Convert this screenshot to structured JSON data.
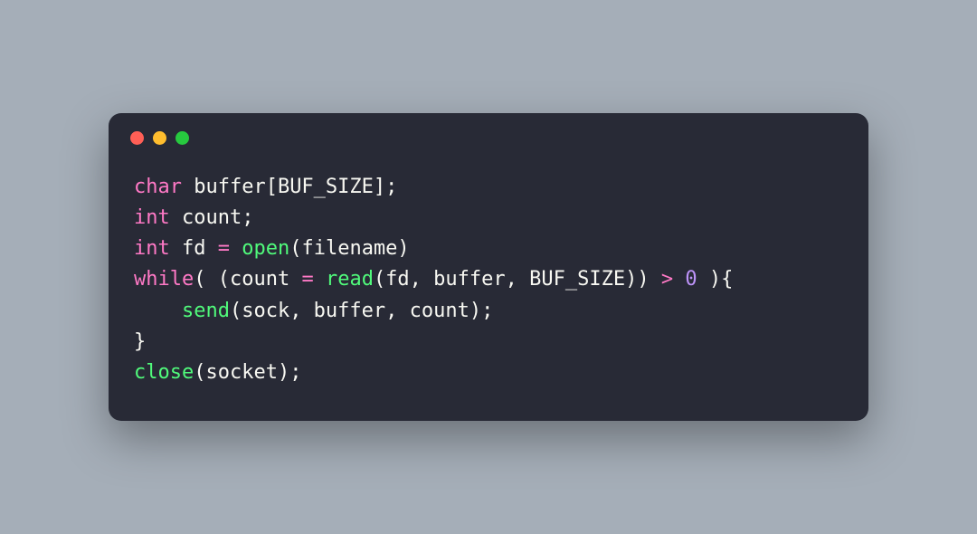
{
  "traffic_lights": {
    "red": "#ff5f56",
    "yellow": "#ffbd2e",
    "green": "#27c93f"
  },
  "code": {
    "tokens": [
      {
        "t": "char",
        "c": "kw-type"
      },
      {
        "t": " buffer[BUF_SIZE];\n",
        "c": "pl"
      },
      {
        "t": "int",
        "c": "kw-type"
      },
      {
        "t": " count;\n",
        "c": "pl"
      },
      {
        "t": "int",
        "c": "kw-type"
      },
      {
        "t": " fd ",
        "c": "pl"
      },
      {
        "t": "=",
        "c": "op"
      },
      {
        "t": " ",
        "c": "pl"
      },
      {
        "t": "open",
        "c": "fn"
      },
      {
        "t": "(filename)\n",
        "c": "pl"
      },
      {
        "t": "while",
        "c": "kw-type"
      },
      {
        "t": "( (count ",
        "c": "pl"
      },
      {
        "t": "=",
        "c": "op"
      },
      {
        "t": " ",
        "c": "pl"
      },
      {
        "t": "read",
        "c": "fn"
      },
      {
        "t": "(fd, buffer, BUF_SIZE)) ",
        "c": "pl"
      },
      {
        "t": ">",
        "c": "op"
      },
      {
        "t": " ",
        "c": "pl"
      },
      {
        "t": "0",
        "c": "num"
      },
      {
        "t": " ){\n",
        "c": "pl"
      },
      {
        "t": "    ",
        "c": "pl"
      },
      {
        "t": "send",
        "c": "fn"
      },
      {
        "t": "(sock, buffer, count);\n",
        "c": "pl"
      },
      {
        "t": "}\n",
        "c": "pl"
      },
      {
        "t": "close",
        "c": "fn"
      },
      {
        "t": "(socket);",
        "c": "pl"
      }
    ],
    "plain": "char buffer[BUF_SIZE];\nint count;\nint fd = open(filename)\nwhile( (count = read(fd, buffer, BUF_SIZE)) > 0 ){\n    send(sock, buffer, count);\n}\nclose(socket);"
  }
}
